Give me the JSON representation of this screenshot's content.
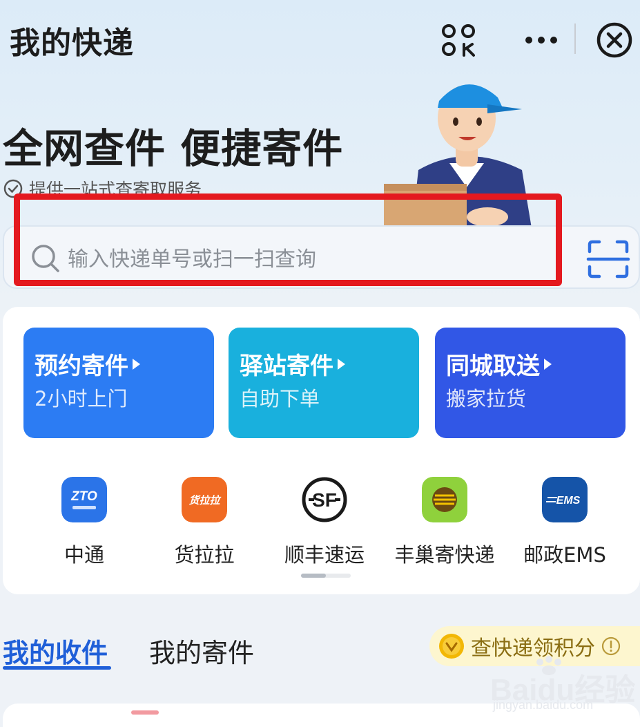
{
  "window": {
    "title": "我的快递"
  },
  "header": {
    "icons": [
      "scan-code-icon",
      "more-icon",
      "close-icon"
    ]
  },
  "hero": {
    "headline": "全网查件 便捷寄件",
    "subline": "提供一站式查寄取服务"
  },
  "search": {
    "placeholder": "输入快递单号或扫一扫查询",
    "value": ""
  },
  "services": [
    {
      "title": "预约寄件",
      "subtitle": "2小时上门",
      "color": "#2c7cf3"
    },
    {
      "title": "驿站寄件",
      "subtitle": "自助下单",
      "color": "#19b0dd"
    },
    {
      "title": "同城取送",
      "subtitle": "搬家拉货",
      "color": "#3157e6"
    }
  ],
  "carriers": [
    {
      "name": "中通",
      "logo_text": "ZTO",
      "color": "#2b74e8"
    },
    {
      "name": "货拉拉",
      "logo_text": "货拉拉",
      "color": "#f06a23"
    },
    {
      "name": "顺丰速运",
      "logo_text": "SF",
      "color": "#ffffff"
    },
    {
      "name": "丰巢寄快递",
      "logo_text": "",
      "color": "#8fd13c"
    },
    {
      "name": "邮政EMS",
      "logo_text": "EMS",
      "color": "#1554a8"
    }
  ],
  "tabs": {
    "active": "我的收件",
    "inactive": "我的寄件"
  },
  "points": {
    "label": "查快递领积分"
  },
  "watermark": {
    "main": "Baidu经验",
    "sub": "jingyan.baidu.com"
  },
  "colors": {
    "highlight": "#e4191f",
    "accent": "#1f5fd8"
  }
}
